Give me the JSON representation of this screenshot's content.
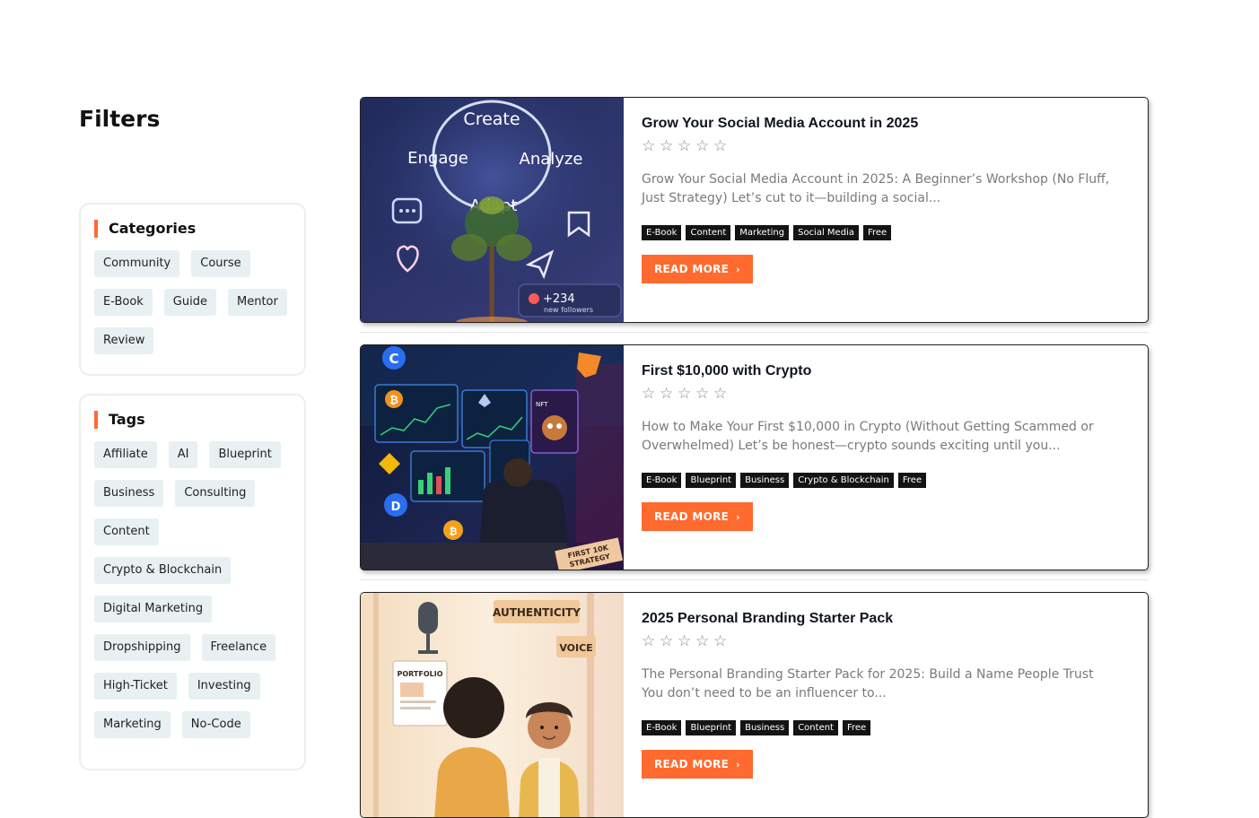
{
  "sidebar": {
    "title": "Filters",
    "categories": {
      "heading": "Categories",
      "items": [
        "Community",
        "Course",
        "E-Book",
        "Guide",
        "Mentor",
        "Review"
      ]
    },
    "tags": {
      "heading": "Tags",
      "items": [
        "Affiliate",
        "AI",
        "Blueprint",
        "Business",
        "Consulting",
        "Content",
        "Crypto & Blockchain",
        "Digital Marketing",
        "Dropshipping",
        "Freelance",
        "High-Ticket",
        "Investing",
        "Marketing",
        "No-Code"
      ]
    }
  },
  "posts": [
    {
      "title": "Grow Your Social Media Account in 2025",
      "rating": 0,
      "excerpt": "Grow Your Social Media Account in 2025: A Beginner’s Workshop (No Fluff, Just Strategy) Let’s cut to it—building a social...",
      "tags": [
        "E-Book",
        "Content",
        "Marketing",
        "Social Media",
        "Free"
      ],
      "button_label": "READ MORE",
      "thumb": {
        "words": [
          "Create",
          "Engage",
          "Analyze",
          "Adapt"
        ],
        "badge_count": "+234",
        "badge_label": "new followers"
      }
    },
    {
      "title": "First $10,000 with Crypto",
      "rating": 0,
      "excerpt": "How to Make Your First $10,000 in Crypto (Without Getting Scammed or Overwhelmed) Let’s be honest—crypto sounds exciting until you...",
      "tags": [
        "E-Book",
        "Blueprint",
        "Business",
        "Crypto & Blockchain",
        "Free"
      ],
      "button_label": "READ MORE",
      "thumb": {
        "nft_label": "NFT",
        "note_line1": "FIRST 10K",
        "note_line2": "STRATEGY"
      }
    },
    {
      "title": "2025 Personal Branding Starter Pack",
      "rating": 0,
      "excerpt": "The Personal Branding Starter Pack for 2025: Build a Name People Trust You don’t need to be an influencer to...",
      "tags": [
        "E-Book",
        "Blueprint",
        "Business",
        "Content",
        "Free"
      ],
      "button_label": "READ MORE",
      "thumb": {
        "label_authenticity": "AUTHENTICITY",
        "label_voice": "VOICE",
        "label_portfolio": "PORTFOLIO"
      }
    }
  ],
  "colors": {
    "accent": "#ff6a2f",
    "chip_bg": "#e8f0f1",
    "tag_bg": "#141414"
  },
  "icons": {
    "star": "star-outline-icon",
    "arrow": "chevron-right-icon"
  }
}
